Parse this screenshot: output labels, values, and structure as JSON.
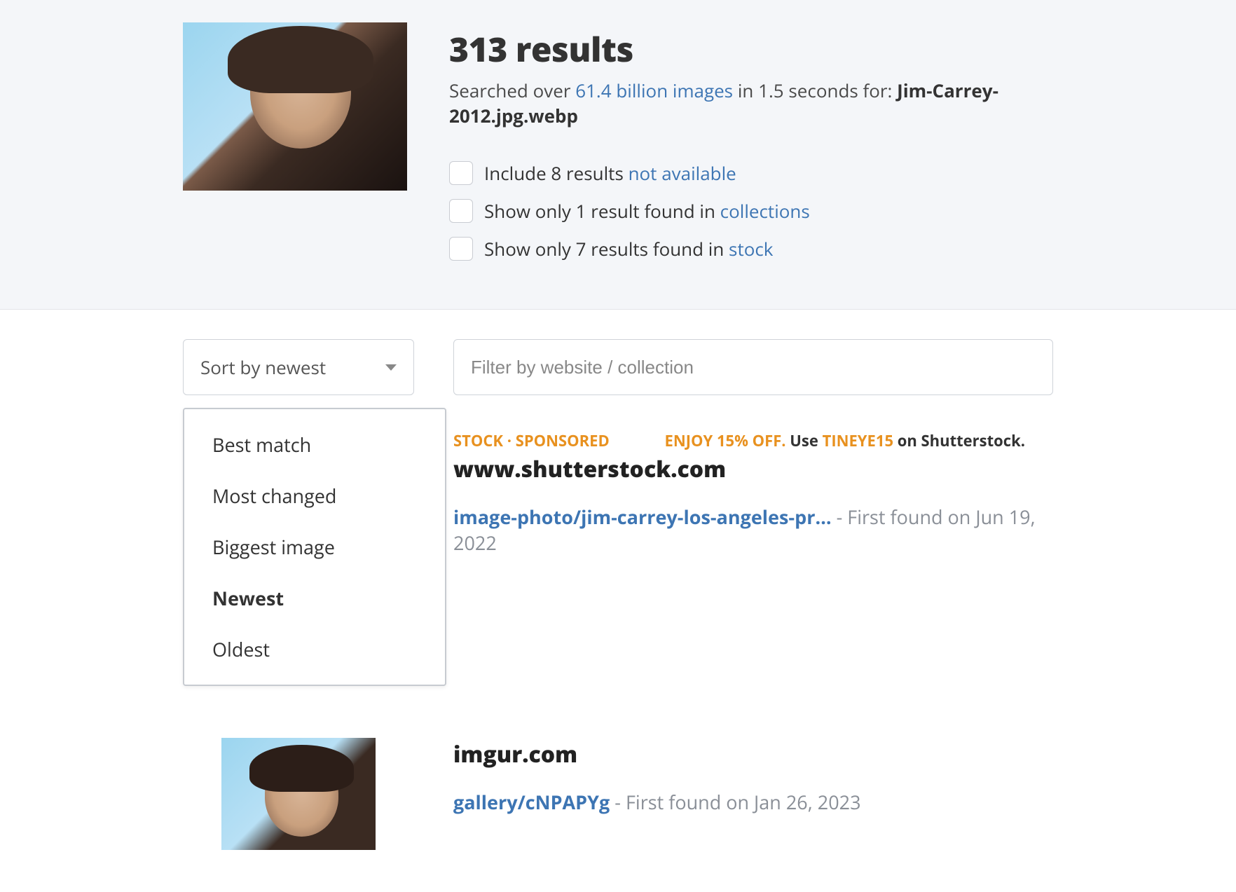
{
  "header": {
    "results_title": "313 results",
    "searched_prefix": "Searched over ",
    "index_size": "61.4 billion images",
    "time_phrase": " in 1.5 seconds for: ",
    "filename": "Jim-Carrey-2012.jpg.webp"
  },
  "filters": {
    "not_available": {
      "prefix": "Include 8 results ",
      "link": "not available"
    },
    "collections": {
      "prefix": "Show only 1 result found in ",
      "link": "collections"
    },
    "stock": {
      "prefix": "Show only 7 results found in ",
      "link": "stock"
    }
  },
  "sort": {
    "selected_label": "Sort by newest",
    "options": [
      "Best match",
      "Most changed",
      "Biggest image",
      "Newest",
      "Oldest"
    ],
    "selected_index": 3
  },
  "filter_input": {
    "placeholder": "Filter by website / collection"
  },
  "results": [
    {
      "badge": "STOCK  ·  SPONSORED",
      "promo_lead": "ENJOY 15% OFF.",
      "promo_mid": " Use ",
      "promo_code": "TINEYE15",
      "promo_tail": " on Shutterstock.",
      "domain": "www.shutterstock.com",
      "path": "image-photo/jim-carrey-los-angeles-pr…",
      "found": "  - First found on Jun 19, 2022"
    },
    {
      "badge": "",
      "promo_lead": "",
      "promo_mid": "",
      "promo_code": "",
      "promo_tail": "",
      "domain": "imgur.com",
      "path": "gallery/cNPAPYg",
      "found": " - First found on Jan 26, 2023"
    }
  ]
}
